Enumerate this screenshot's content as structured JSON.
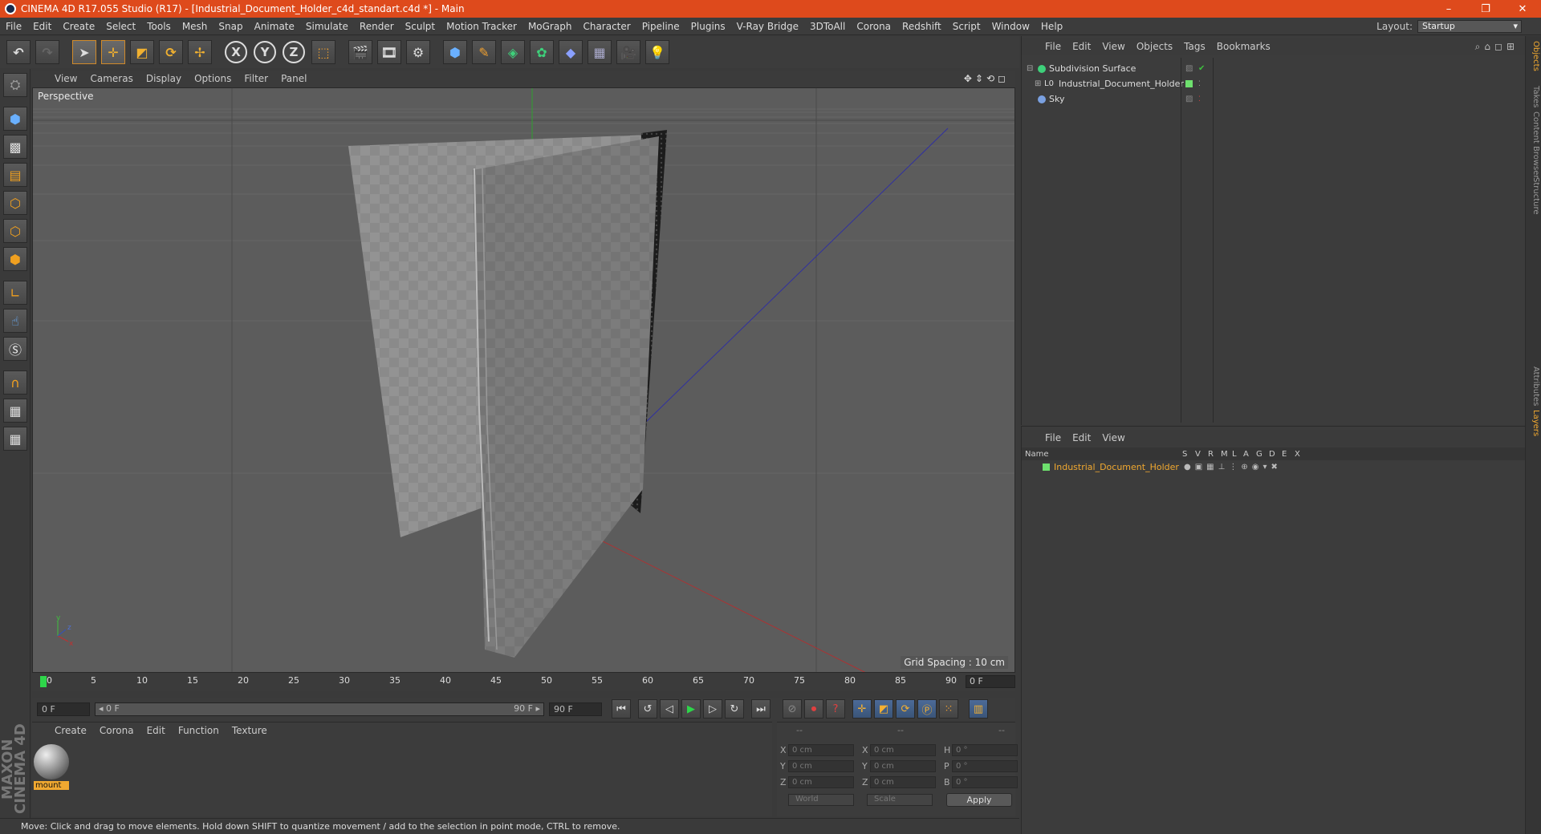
{
  "window": {
    "title": "CINEMA 4D R17.055 Studio (R17) - [Industrial_Document_Holder_c4d_standart.c4d *] - Main",
    "controls": [
      "–",
      "❐",
      "✕"
    ]
  },
  "menubar": {
    "items": [
      "File",
      "Edit",
      "Create",
      "Select",
      "Tools",
      "Mesh",
      "Snap",
      "Animate",
      "Simulate",
      "Render",
      "Sculpt",
      "Motion Tracker",
      "MoGraph",
      "Character",
      "Pipeline",
      "Plugins",
      "V-Ray Bridge",
      "3DToAll",
      "Corona",
      "Redshift",
      "Script",
      "Window",
      "Help"
    ],
    "layout_label": "Layout:",
    "layout_value": "Startup"
  },
  "toolbar": {
    "x": "X",
    "y": "Y",
    "z": "Z"
  },
  "viewport": {
    "menu": [
      "View",
      "Cameras",
      "Display",
      "Options",
      "Filter",
      "Panel"
    ],
    "camera_label": "Perspective",
    "grid_spacing": "Grid Spacing : 10 cm"
  },
  "timeline": {
    "ticks": [
      "0",
      "5",
      "10",
      "15",
      "20",
      "25",
      "30",
      "35",
      "40",
      "45",
      "50",
      "55",
      "60",
      "65",
      "70",
      "75",
      "80",
      "85",
      "90"
    ],
    "current_frame": "0 F"
  },
  "transport": {
    "start": "0 F",
    "range_start": "◂ 0 F",
    "range_end": "90 F ▸",
    "end": "90 F"
  },
  "material": {
    "menu": [
      "Create",
      "Corona",
      "Edit",
      "Function",
      "Texture"
    ],
    "name": "mount"
  },
  "coords": {
    "header": [
      "--",
      "--",
      "--"
    ],
    "rows": [
      {
        "a": "X",
        "av": "0 cm",
        "b": "X",
        "bv": "0 cm",
        "c": "H",
        "cv": "0 °"
      },
      {
        "a": "Y",
        "av": "0 cm",
        "b": "Y",
        "bv": "0 cm",
        "c": "P",
        "cv": "0 °"
      },
      {
        "a": "Z",
        "av": "0 cm",
        "b": "Z",
        "bv": "0 cm",
        "c": "B",
        "cv": "0 °"
      }
    ],
    "space": "World",
    "mode": "Scale",
    "apply": "Apply"
  },
  "status": "Move: Click and drag to move elements. Hold down SHIFT to quantize movement / add to the selection in point mode, CTRL to remove.",
  "brand": "MAXON CINEMA 4D",
  "objects": {
    "menu": [
      "File",
      "Edit",
      "View",
      "Objects",
      "Tags",
      "Bookmarks"
    ],
    "items": [
      {
        "name": "Subdivision Surface"
      },
      {
        "name": "Industrial_Document_Holder"
      },
      {
        "name": "Sky"
      }
    ]
  },
  "layers": {
    "menu": [
      "File",
      "Edit",
      "View"
    ],
    "columns": [
      "Name",
      "S",
      "V",
      "R",
      "M",
      "L",
      "A",
      "G",
      "D",
      "E",
      "X"
    ],
    "row": "Industrial_Document_Holder"
  },
  "right_tabs": [
    "Objects",
    "Takes",
    "Content Browser",
    "Structure",
    "Attributes",
    "Layers"
  ],
  "colors": {
    "accent": "#de4a1c",
    "highlight": "#f0a830",
    "layer_green": "#6ee06e"
  }
}
